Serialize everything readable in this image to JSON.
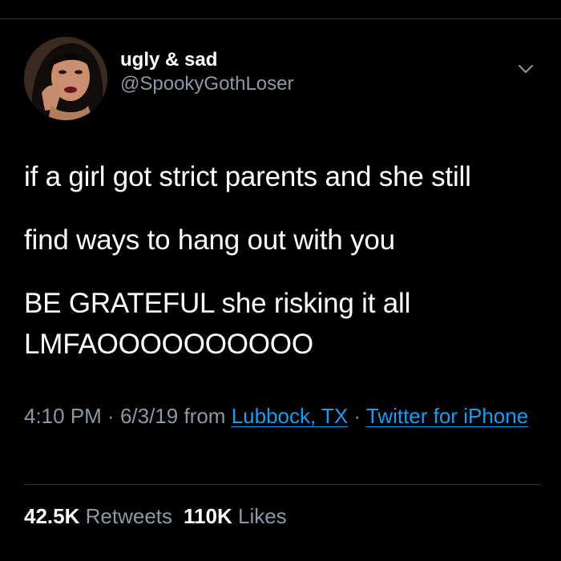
{
  "user": {
    "display_name": "ugly & sad",
    "handle": "@SpookyGothLoser",
    "avatar_icon": "profile-photo"
  },
  "menu": {
    "icon": "chevron-down-icon"
  },
  "tweet": {
    "lines": [
      "if a girl got strict parents and she still",
      "find ways to hang out with you",
      "BE GRATEFUL she risking it all",
      "LMFAOOOOOOOOOO"
    ]
  },
  "meta": {
    "time": "4:10 PM",
    "sep1": " · ",
    "date": "6/3/19",
    "from_text": " from ",
    "location": "Lubbock, TX",
    "sep2": " · ",
    "source": "Twitter for iPhone"
  },
  "stats": {
    "retweets_count": "42.5K",
    "retweets_label": "Retweets",
    "likes_count": "110K",
    "likes_label": "Likes"
  },
  "colors": {
    "background": "#000000",
    "text": "#ffffff",
    "secondary_text": "#8b98a5",
    "link": "#1d9bf0",
    "divider": "#2f3336"
  }
}
